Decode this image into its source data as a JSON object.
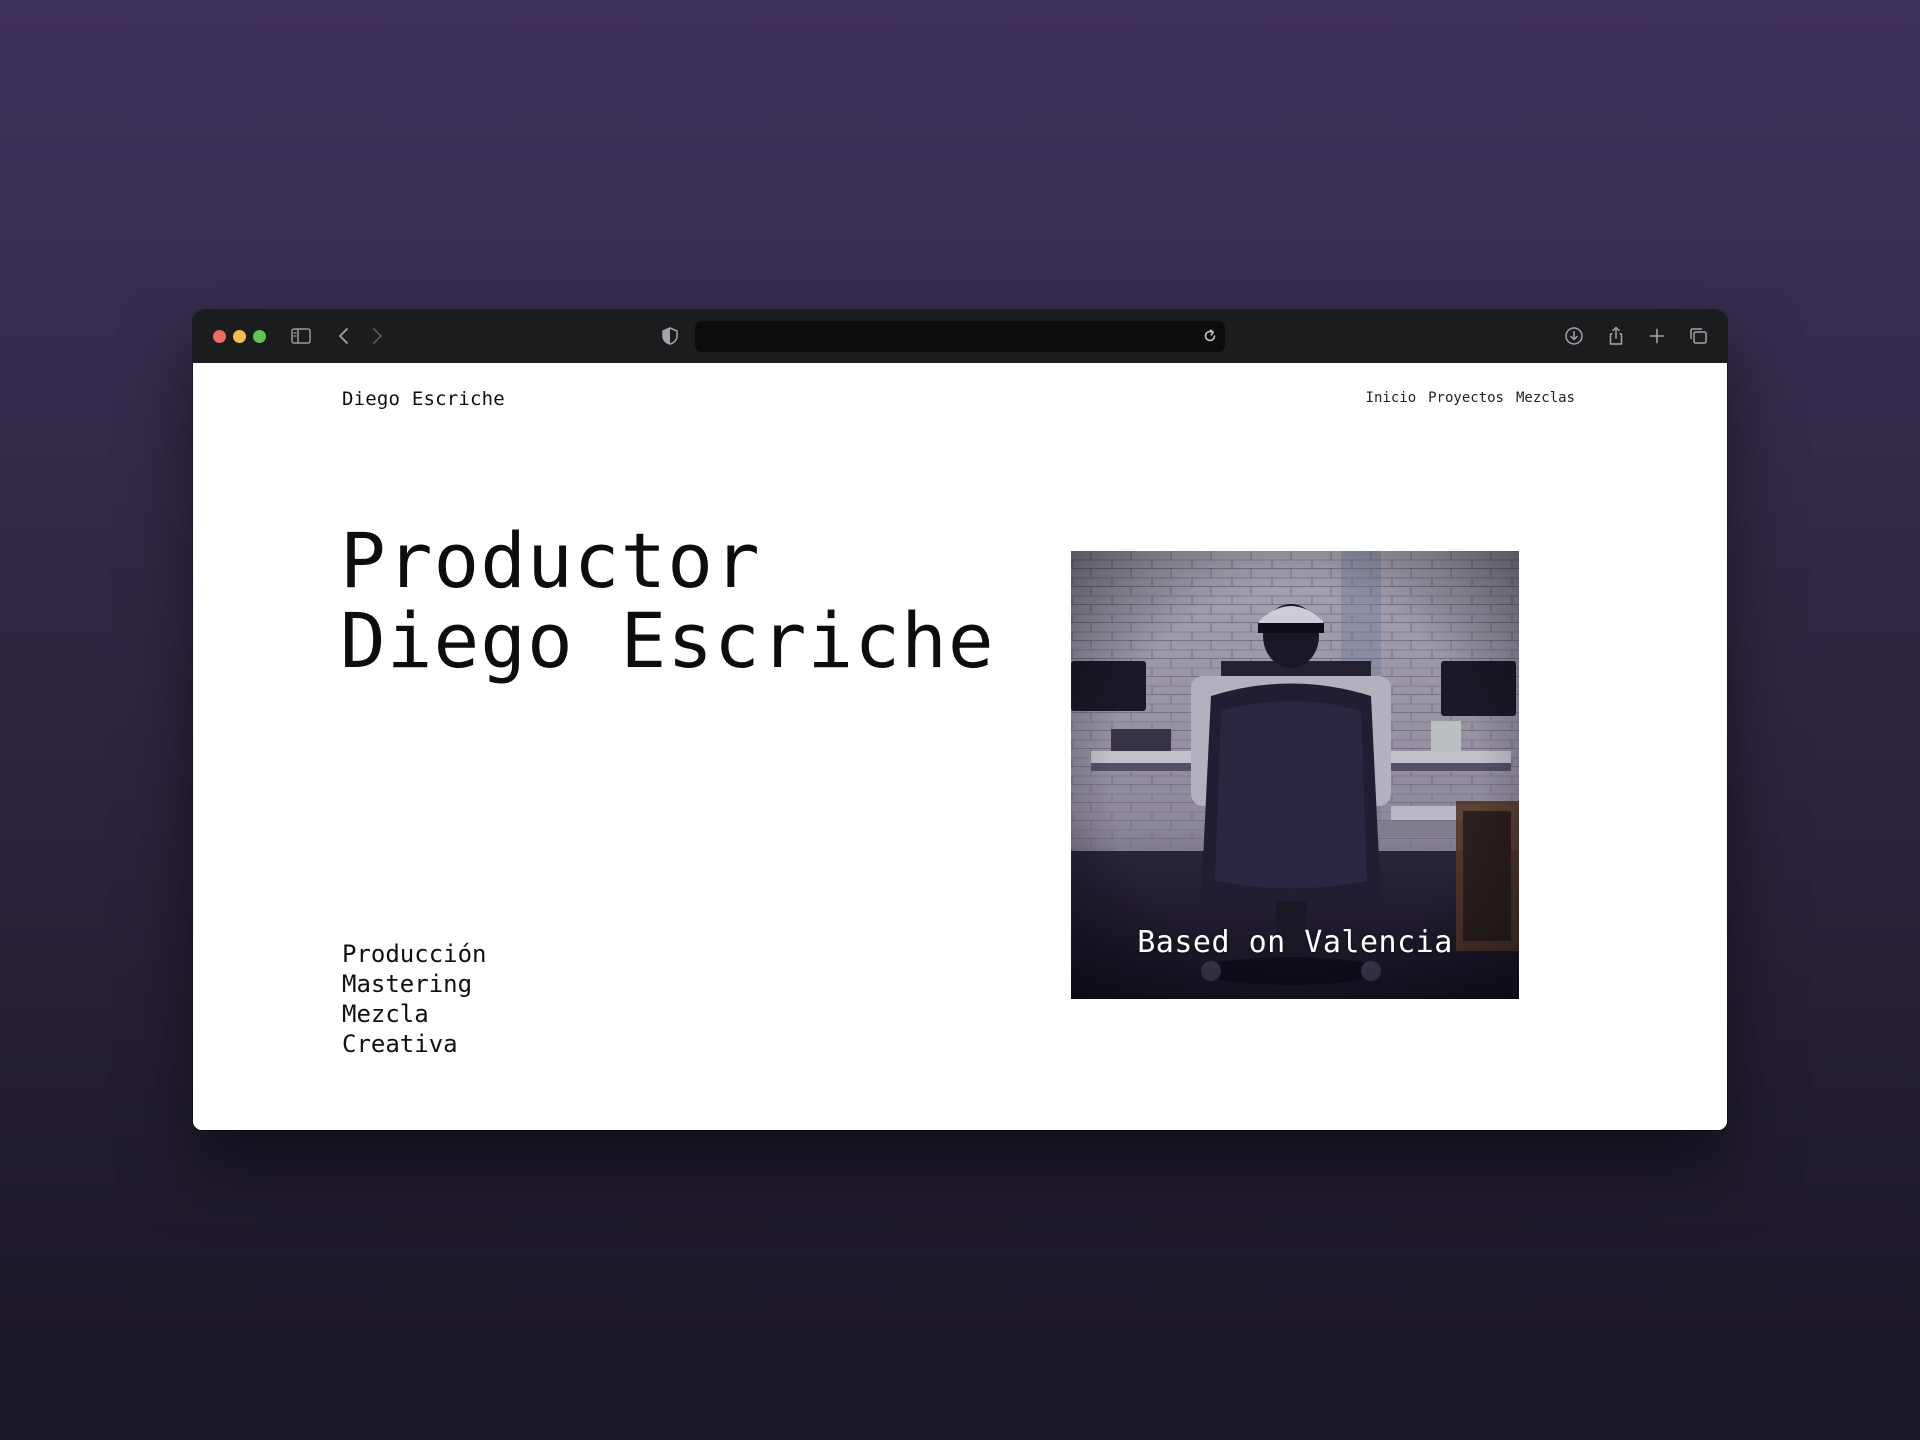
{
  "browser": {
    "sidebar_icon": "sidebar-icon",
    "back_icon": "chevron-left-icon",
    "forward_icon": "chevron-right-icon",
    "shield_icon": "shield-icon",
    "reload_icon": "reload-icon",
    "download_icon": "download-icon",
    "share_icon": "share-icon",
    "new_tab_icon": "plus-icon",
    "tabs_icon": "tabs-overview-icon",
    "url": ""
  },
  "site": {
    "brand": "Diego Escriche",
    "nav": [
      "Inicio",
      "Proyectos",
      "Mezclas"
    ]
  },
  "hero": {
    "title_line1": "Productor",
    "title_line2": "Diego Escriche",
    "services": [
      "Producción",
      "Mastering",
      "Mezcla",
      "Creativa"
    ],
    "photo_caption": "Based on Valencia"
  },
  "colors": {
    "background": "#3e3159",
    "toolbar": "#1b1c1e",
    "traffic_red": "#ed6a5e",
    "traffic_yellow": "#f5bf4f",
    "traffic_green": "#61c554"
  }
}
